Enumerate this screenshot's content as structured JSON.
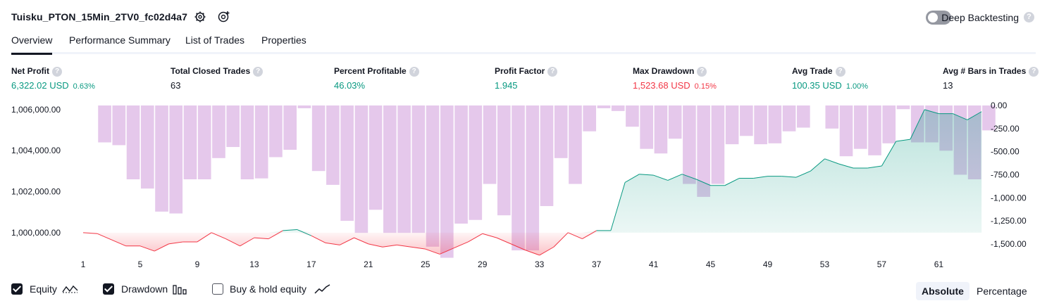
{
  "header": {
    "title": "Tuisku_PTON_15Min_2TV0_fc02d4a7",
    "settings_icon": "gear-icon",
    "snapshot_icon": "camera-plus-icon",
    "deep_backtesting_label": "Deep Backtesting",
    "deep_backtesting_on": false,
    "help_icon": "question-icon"
  },
  "tabs": [
    {
      "label": "Overview",
      "active": true
    },
    {
      "label": "Performance Summary",
      "active": false
    },
    {
      "label": "List of Trades",
      "active": false
    },
    {
      "label": "Properties",
      "active": false
    }
  ],
  "stats": [
    {
      "label": "Net Profit",
      "value": "6,322.02 USD",
      "pct": "0.63%",
      "color": "#089981"
    },
    {
      "label": "Total Closed Trades",
      "value": "63",
      "pct": "",
      "color": "#131722"
    },
    {
      "label": "Percent Profitable",
      "value": "46.03%",
      "pct": "",
      "color": "#089981"
    },
    {
      "label": "Profit Factor",
      "value": "1.945",
      "pct": "",
      "color": "#089981"
    },
    {
      "label": "Max Drawdown",
      "value": "1,523.68 USD",
      "pct": "0.15%",
      "color": "#f23645"
    },
    {
      "label": "Avg Trade",
      "value": "100.35 USD",
      "pct": "1.00%",
      "color": "#089981"
    },
    {
      "label": "Avg # Bars in Trades",
      "value": "13",
      "pct": "",
      "color": "#131722"
    }
  ],
  "chart_data": {
    "type": "area",
    "x": [
      1,
      2,
      3,
      4,
      5,
      6,
      7,
      8,
      9,
      10,
      11,
      12,
      13,
      14,
      15,
      16,
      17,
      18,
      19,
      20,
      21,
      22,
      23,
      24,
      25,
      26,
      27,
      28,
      29,
      30,
      31,
      32,
      33,
      34,
      35,
      36,
      37,
      38,
      39,
      40,
      41,
      42,
      43,
      44,
      45,
      46,
      47,
      48,
      49,
      50,
      51,
      52,
      53,
      54,
      55,
      56,
      57,
      58,
      59,
      60,
      61,
      62,
      63,
      64
    ],
    "x_ticks": [
      "1",
      "5",
      "9",
      "13",
      "17",
      "21",
      "25",
      "29",
      "33",
      "37",
      "41",
      "45",
      "49",
      "53",
      "57",
      "61"
    ],
    "left_axis_ticks": [
      "1,006,000.00",
      "1,004,000.00",
      "1,002,000.00",
      "1,000,000.00"
    ],
    "right_axis_ticks": [
      "0.00",
      "-250.00",
      "-500.00",
      "-750.00",
      "-1,000.00",
      "-1,250.00",
      "-1,500.00"
    ],
    "left_ylim": [
      999000,
      1006200
    ],
    "right_ylim": [
      -1600,
      0
    ],
    "series": [
      {
        "name": "Equity",
        "axis": "left",
        "color_up": "#089981",
        "color_down": "#f23645",
        "values": [
          1000000,
          999950,
          999650,
          999350,
          999350,
          999100,
          999450,
          999550,
          999550,
          1000000,
          999700,
          999350,
          999750,
          999700,
          1000100,
          1000150,
          999850,
          999500,
          999400,
          999750,
          999450,
          999300,
          999400,
          999300,
          999200,
          998950,
          999250,
          999550,
          999950,
          999750,
          999450,
          999150,
          998900,
          999300,
          1000000,
          999700,
          1000100,
          1000100,
          1002450,
          1002850,
          1002800,
          1002550,
          1002850,
          1002600,
          1002300,
          1002300,
          1002650,
          1002650,
          1002750,
          1002750,
          1002700,
          1003000,
          1003600,
          1003350,
          1003150,
          1003150,
          1003250,
          1004450,
          1004550,
          1006000,
          1005800,
          1005800,
          1005500,
          1005900
        ]
      },
      {
        "name": "Drawdown",
        "axis": "right",
        "color": "#e1bee7",
        "values": [
          0,
          -400,
          -430,
          -800,
          -900,
          -1150,
          -1170,
          -800,
          -800,
          -570,
          -450,
          -800,
          -790,
          -560,
          -480,
          -30,
          -710,
          -860,
          -1250,
          -1380,
          -1130,
          -1380,
          -1380,
          -1380,
          -1530,
          -1650,
          -1280,
          -1240,
          -850,
          -1190,
          -1570,
          -1570,
          -1090,
          -570,
          -850,
          -280,
          -30,
          -60,
          -230,
          -470,
          -520,
          -360,
          -850,
          -990,
          -850,
          -420,
          -330,
          -420,
          -410,
          -280,
          -240,
          0,
          -250,
          -550,
          -470,
          -540,
          -410,
          -40,
          -400,
          -400,
          -490,
          -750,
          -800,
          -270
        ]
      }
    ],
    "legend": [
      "Equity",
      "Drawdown",
      "Buy & hold equity"
    ]
  },
  "legend": {
    "equity_label": "Equity",
    "equity_checked": true,
    "equity_icon": "equity-line-icon",
    "drawdown_label": "Drawdown",
    "drawdown_checked": true,
    "drawdown_icon": "drawdown-bars-icon",
    "buyhold_label": "Buy & hold equity",
    "buyhold_checked": false,
    "buyhold_icon": "buy-hold-line-icon"
  },
  "mode": {
    "absolute_label": "Absolute",
    "percentage_label": "Percentage",
    "selected": "Absolute"
  }
}
